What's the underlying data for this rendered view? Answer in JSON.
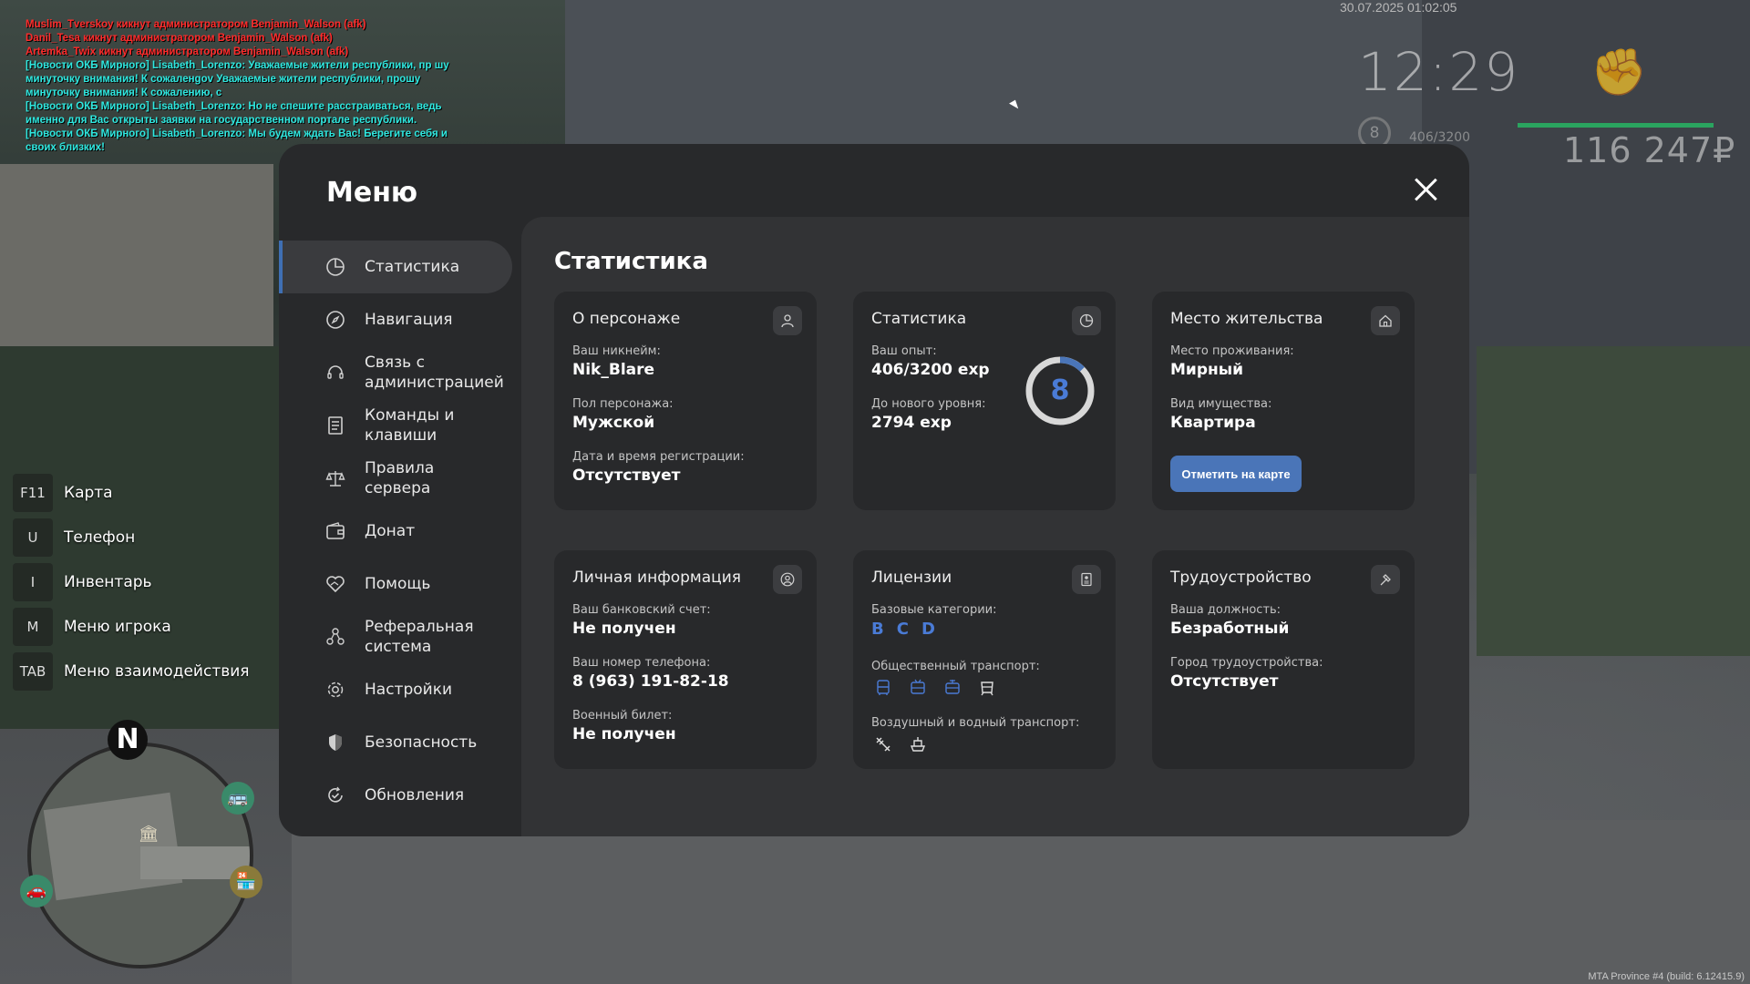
{
  "chat": [
    {
      "text": "Muslim_Tverskoy кикнут администратором Benjamin_Walson (afk)",
      "color": "red"
    },
    {
      "text": "Danil_Tesa кикнут администратором Benjamin_Walson (afk)",
      "color": "red"
    },
    {
      "text": "Artemka_Twix кикнут администратором Benjamin_Walson (afk)",
      "color": "red"
    },
    {
      "text": "[Новости ОКБ Мирного] Lisabeth_Lorenzo: Уважаемые жители республики, пр шу минуточку внимания! К сожаленgov Уважаемые жители республики, прошу минуточку внимания! К сожалению, с",
      "color": "cyan"
    },
    {
      "text": "[Новости ОКБ Мирного] Lisabeth_Lorenzo: Но не спешите расстраиваться, ведь именно для Вас открыты заявки на государственном портале республики.",
      "color": "cyan"
    },
    {
      "text": "[Новости ОКБ Мирного] Lisabeth_Lorenzo: Мы будем ждать Вас! Берегите себя и своих близких!",
      "color": "cyan"
    }
  ],
  "hud": {
    "date": "30.07.2025 01:02:05",
    "time": "12:29",
    "level": "8",
    "exp": "406/3200",
    "money": "116 247₽",
    "build": "MTA Province #4 (build: 6.12415.9)"
  },
  "hotkeys": [
    {
      "key": "F11",
      "label": "Карта"
    },
    {
      "key": "U",
      "label": "Телефон"
    },
    {
      "key": "I",
      "label": "Инвентарь"
    },
    {
      "key": "M",
      "label": "Меню игрока"
    },
    {
      "key": "TAB",
      "label": "Меню взаимодействия"
    }
  ],
  "minimap": {
    "north": "N"
  },
  "menu": {
    "title": "Меню",
    "sidebar": [
      {
        "label": "Статистика",
        "icon": "pie-chart-icon",
        "active": true
      },
      {
        "label": "Навигация",
        "icon": "compass-icon"
      },
      {
        "label": "Связь с администрацией",
        "icon": "headset-icon"
      },
      {
        "label": "Команды и клавиши",
        "icon": "document-icon"
      },
      {
        "label": "Правила сервера",
        "icon": "scales-icon"
      },
      {
        "label": "Донат",
        "icon": "wallet-icon"
      },
      {
        "label": "Помощь",
        "icon": "handshake-heart-icon"
      },
      {
        "label": "Реферальная система",
        "icon": "referral-icon"
      },
      {
        "label": "Настройки",
        "icon": "gear-icon"
      },
      {
        "label": "Безопасность",
        "icon": "shield-icon"
      },
      {
        "label": "Обновления",
        "icon": "refresh-check-icon"
      }
    ],
    "content_title": "Статистика",
    "cards": {
      "character": {
        "title": "О персонаже",
        "nickname_label": "Ваш никнейм:",
        "nickname": "Nik_Blare",
        "gender_label": "Пол персонажа:",
        "gender": "Мужской",
        "reg_label": "Дата и время регистрации:",
        "reg": "Отсутствует"
      },
      "stats": {
        "title": "Статистика",
        "exp_label": "Ваш опыт:",
        "exp": "406/3200 exp",
        "next_label": "До нового уровня:",
        "next": "2794 exp",
        "level": "8",
        "progress": 0.127
      },
      "residence": {
        "title": "Место жительства",
        "place_label": "Место проживания:",
        "place": "Мирный",
        "type_label": "Вид имущества:",
        "type": "Квартира",
        "button": "Отметить на карте"
      },
      "personal": {
        "title": "Личная информация",
        "bank_label": "Ваш банковский счет:",
        "bank": "Не получен",
        "phone_label": "Ваш номер телефона:",
        "phone": "8 (963) 191-82-18",
        "military_label": "Военный билет:",
        "military": "Не получен"
      },
      "licenses": {
        "title": "Лицензии",
        "basic_label": "Базовые категории:",
        "categories": [
          "B",
          "C",
          "D"
        ],
        "public_label": "Общественный транспорт:",
        "air_label": "Воздушный и водный транспорт:"
      },
      "job": {
        "title": "Трудоустройство",
        "position_label": "Ваша должность:",
        "position": "Безработный",
        "city_label": "Город трудоустройства:",
        "city": "Отсутствует"
      }
    }
  },
  "colors": {
    "accent": "#4a75b8",
    "panel": "#28292b",
    "content": "#323335"
  }
}
